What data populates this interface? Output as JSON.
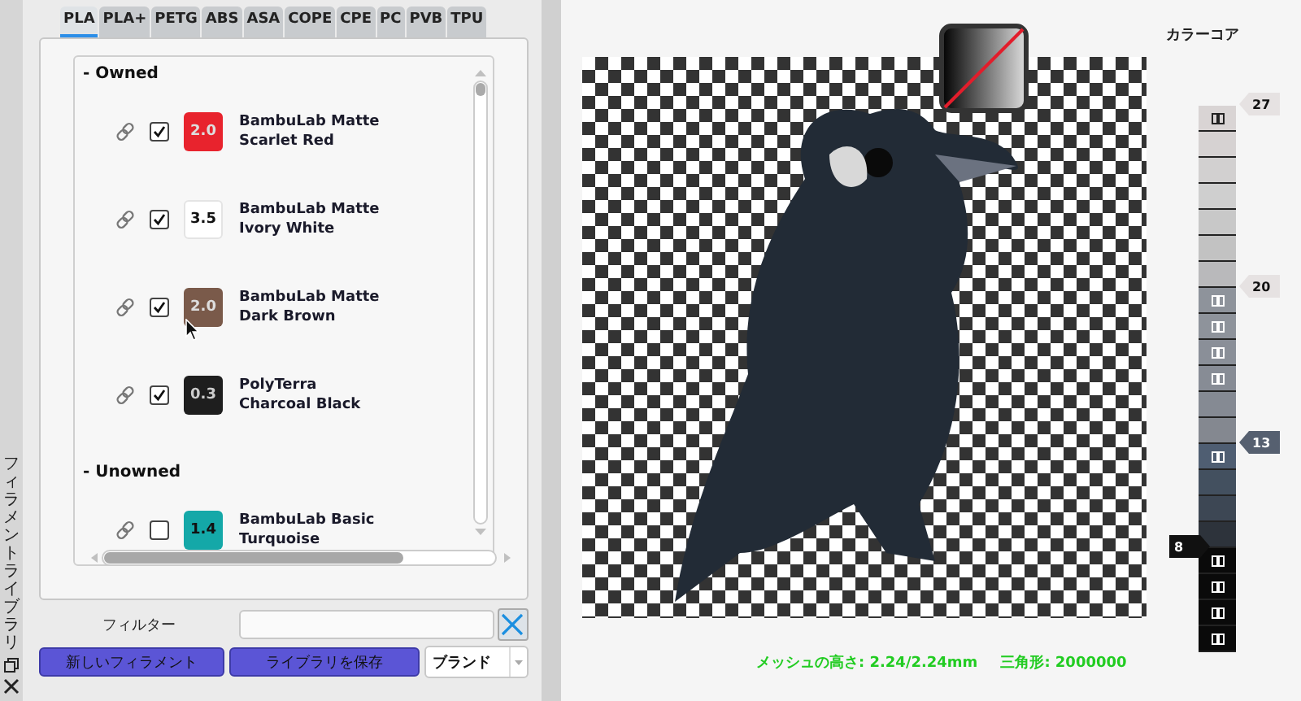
{
  "side_strip": {
    "title": "フィラメントライブラリ"
  },
  "tabs": [
    {
      "label": "PLA",
      "selected": true
    },
    {
      "label": "PLA+",
      "selected": false
    },
    {
      "label": "PETG",
      "selected": false
    },
    {
      "label": "ABS",
      "selected": false
    },
    {
      "label": "ASA",
      "selected": false
    },
    {
      "label": "COPE",
      "selected": false
    },
    {
      "label": "CPE",
      "selected": false
    },
    {
      "label": "PC",
      "selected": false
    },
    {
      "label": "PVB",
      "selected": false
    },
    {
      "label": "TPU",
      "selected": false
    }
  ],
  "groups": [
    {
      "title": "- Owned",
      "items": [
        {
          "value": "2.0",
          "color": "#e8232d",
          "name": "BambuLab Matte",
          "color_name": "Scarlet Red",
          "checked": true
        },
        {
          "value": "3.5",
          "color": "#ffffff",
          "name": "BambuLab Matte",
          "color_name": "Ivory White",
          "checked": true
        },
        {
          "value": "2.0",
          "color": "#7a5a4a",
          "name": "BambuLab Matte",
          "color_name": "Dark Brown",
          "checked": true
        },
        {
          "value": "0.3",
          "color": "#1e1e1e",
          "name": "PolyTerra",
          "color_name": "Charcoal Black",
          "checked": true
        }
      ]
    },
    {
      "title": "- Unowned",
      "items": [
        {
          "value": "1.4",
          "color": "#14a8a8",
          "name": "BambuLab Basic",
          "color_name": "Turquoise",
          "checked": false
        }
      ]
    }
  ],
  "filter": {
    "label": "フィルター"
  },
  "buttons": [
    {
      "label": "新しいフィラメント"
    },
    {
      "label": "ライブラリを保存"
    }
  ],
  "sort_dropdown": {
    "value": "ブランド"
  },
  "color_core": {
    "title": "カラーコア",
    "bands": [
      {
        "marker": "27",
        "kind": "right",
        "color": "#e6e2e2",
        "segments": [
          {
            "color": "#d9d4d4",
            "marked": true
          },
          {
            "color": "#d6d2d2",
            "marked": false
          },
          {
            "color": "#d2d0d0",
            "marked": false
          },
          {
            "color": "#cfcfcf",
            "marked": false
          },
          {
            "color": "#c8c8c8",
            "marked": false
          },
          {
            "color": "#c2c2c2",
            "marked": false
          },
          {
            "color": "#b9b9bb",
            "marked": false
          }
        ]
      },
      {
        "marker": "20",
        "kind": "right",
        "color": "#e6e2e2",
        "segments": [
          {
            "color": "#8e939b",
            "marked": true
          },
          {
            "color": "#8e939b",
            "marked": true
          },
          {
            "color": "#8a8f98",
            "marked": true
          },
          {
            "color": "#878c95",
            "marked": true
          },
          {
            "color": "#858a93",
            "marked": false
          },
          {
            "color": "#848890",
            "marked": false
          }
        ]
      },
      {
        "marker": "13",
        "kind": "right",
        "color": "#566070",
        "segments": [
          {
            "color": "#4f5e72",
            "marked": true
          },
          {
            "color": "#43505f",
            "marked": false
          },
          {
            "color": "#3d4754",
            "marked": false
          },
          {
            "color": "#2d333b",
            "marked": false
          }
        ]
      },
      {
        "marker": "8",
        "kind": "left",
        "color": "#111111",
        "segments": [
          {
            "color": "#0a0a0a",
            "marked": true
          },
          {
            "color": "#0a0a0a",
            "marked": true
          },
          {
            "color": "#0a0a0a",
            "marked": true
          },
          {
            "color": "#0a0a0a",
            "marked": true
          }
        ]
      }
    ]
  },
  "status": {
    "mesh_height": "メッシュの高さ: 2.24/2.24mm",
    "triangles": "三角形: 2000000"
  }
}
